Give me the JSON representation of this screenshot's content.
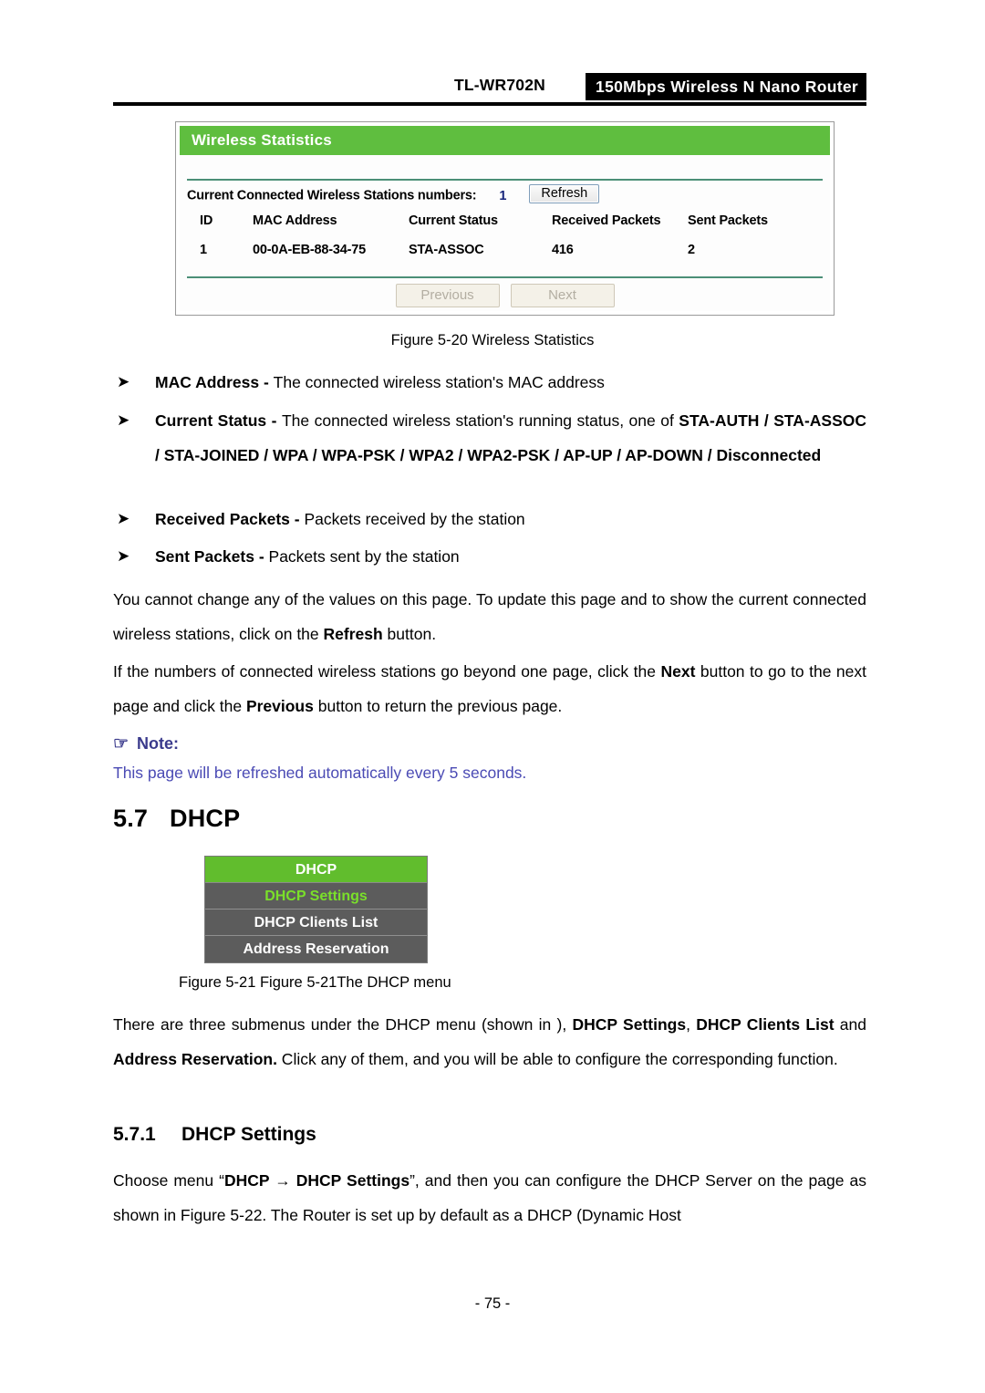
{
  "header": {
    "model": "TL-WR702N",
    "banner": "150Mbps  Wireless  N  Nano  Router"
  },
  "screenshot": {
    "panel_title": "Wireless Statistics",
    "stations_label": "Current Connected Wireless Stations numbers:",
    "stations_count": "1",
    "refresh_button": "Refresh",
    "columns": [
      "ID",
      "MAC Address",
      "Current Status",
      "Received Packets",
      "Sent Packets"
    ],
    "rows": [
      {
        "id": "1",
        "mac": "00-0A-EB-88-34-75",
        "status": "STA-ASSOC",
        "received": "416",
        "sent": "2"
      }
    ],
    "previous_button": "Previous",
    "next_button": "Next"
  },
  "captions": {
    "figure_5_20": "Figure 5-20 Wireless Statistics",
    "figure_5_21": "Figure 5-21 Figure 5-21The DHCP menu"
  },
  "bullets": [
    {
      "term": "MAC Address",
      "dash": " - ",
      "text": "The connected wireless station's MAC address"
    },
    {
      "term": "Current Status",
      "dash": " - ",
      "text": "The connected wireless station's running status, one of ",
      "values": "STA-AUTH / STA-ASSOC / STA-JOINED / WPA / WPA-PSK / WPA2 / WPA2-PSK / AP-UP / AP-DOWN / Disconnected"
    },
    {
      "term": "Received Packets",
      "dash": " - ",
      "text": "Packets received by the station"
    },
    {
      "term": "Sent Packets",
      "dash": " - ",
      "text": "Packets sent by the station"
    }
  ],
  "paragraphs": {
    "p1_a": "You cannot change any of the values on this page. To update this page and to show the current connected wireless stations, click on the ",
    "p1_b": "Refresh",
    "p1_c": " button.",
    "p2_a": "If the numbers of connected wireless stations go beyond one page, click the ",
    "p2_b": "Next",
    "p2_c": " button to go to the next page and click the ",
    "p2_d": "Previous",
    "p2_e": " button to return the previous page.",
    "p3_a": "There are three submenus under the DHCP menu (shown in ), ",
    "p3_b": "DHCP Settings",
    "p3_c": ", ",
    "p3_d": "DHCP Clients List",
    "p3_e": " and ",
    "p3_f": "Address Reservation.",
    "p3_g": " Click any of them, and you will be able to configure the corresponding function.",
    "p4_a": "Choose menu “",
    "p4_b": "DHCP  →  DHCP Settings",
    "p4_c": "”, and then you can configure the DHCP Server on the page as shown in Figure 5-22. The Router is set up by default as a DHCP (Dynamic Host"
  },
  "note": {
    "hand_icon": "☞",
    "title": "Note:",
    "text": "This page will be refreshed automatically every 5 seconds."
  },
  "sections": {
    "s57_num": "5.7",
    "s57_title": "DHCP",
    "s571_num": "5.7.1",
    "s571_title": "DHCP Settings"
  },
  "dhcp_menu": {
    "items": [
      {
        "label": "DHCP",
        "type": "root",
        "active": false
      },
      {
        "label": "DHCP Settings",
        "type": "sub",
        "active": true
      },
      {
        "label": "DHCP Clients List",
        "type": "sub",
        "active": false
      },
      {
        "label": "Address Reservation",
        "type": "sub",
        "active": false
      }
    ]
  },
  "footer": {
    "page_number": "- 75 -"
  },
  "colors": {
    "panel_green": "#5fbe3f",
    "menu_green": "#61bd2d",
    "menu_active_green": "#7ae02a",
    "menu_gray": "#5c5c5c",
    "note_blue": "#4a4ab4",
    "count_blue": "#16247a"
  }
}
